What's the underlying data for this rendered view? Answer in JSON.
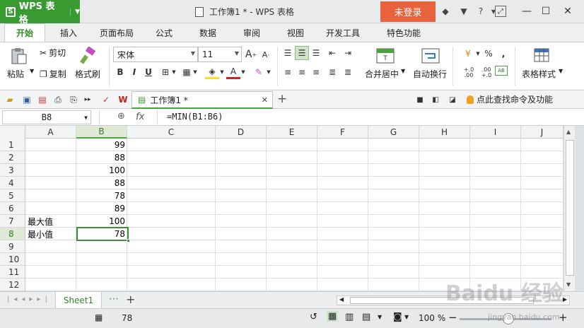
{
  "app": {
    "name": "WPS 表格",
    "doc_title": "工作簿1 * - WPS 表格",
    "login_label": "未登录"
  },
  "menu_tabs": [
    "开始",
    "插入",
    "页面布局",
    "公式",
    "数据",
    "审阅",
    "视图",
    "开发工具",
    "特色功能"
  ],
  "ribbon": {
    "paste": "粘贴",
    "cut": "剪切",
    "copy": "复制",
    "format_painter": "格式刷",
    "font_name": "宋体",
    "font_size": "11",
    "merge_center": "合并居中",
    "wrap_text": "自动换行",
    "table_style": "表格样式",
    "percent": "%",
    "dec_inc": "+.0 .00",
    "dec_dec": ".00 +.0"
  },
  "doc_tab": {
    "label": "工作簿1 *"
  },
  "search_command": "点此查找命令及功能",
  "formula_bar": {
    "name_box": "B8",
    "fx": "fx",
    "formula": "=MIN(B1:B6)"
  },
  "columns": [
    "A",
    "B",
    "C",
    "D",
    "E",
    "F",
    "G",
    "H",
    "I",
    "J"
  ],
  "rows": [
    "1",
    "2",
    "3",
    "4",
    "5",
    "6",
    "7",
    "8",
    "9",
    "10",
    "11",
    "12"
  ],
  "cells": {
    "A7": "最大值",
    "A8": "最小值",
    "B1": "99",
    "B2": "88",
    "B3": "100",
    "B4": "88",
    "B5": "78",
    "B6": "89",
    "B7": "100",
    "B8": "78"
  },
  "selected_cell": "B8",
  "sheet_tabs": [
    "Sheet1"
  ],
  "status": {
    "value": "78",
    "zoom": "100 %"
  },
  "watermark": {
    "main": "Baidu 经验",
    "sub": "jingyan.baidu.com"
  },
  "colors": {
    "accent": "#3a9a32",
    "login": "#e8623e"
  }
}
